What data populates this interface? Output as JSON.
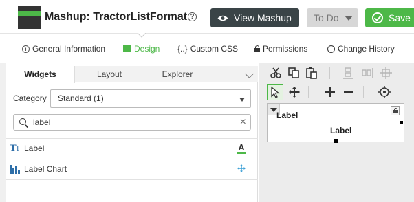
{
  "header": {
    "title": "Mashup: TractorListFormat",
    "help_icon": "?",
    "view_button": "View Mashup",
    "todo_button": "To Do",
    "save_button": "Save"
  },
  "nav": {
    "items": [
      {
        "label": "General Information",
        "icon": "info-circle-icon",
        "active": false
      },
      {
        "label": "Design",
        "icon": "design-icon",
        "active": true
      },
      {
        "label": "Custom CSS",
        "icon": "css-braces-icon",
        "prefix": "{..}",
        "active": false
      },
      {
        "label": "Permissions",
        "icon": "lock-icon",
        "active": false
      },
      {
        "label": "Change History",
        "icon": "clock-icon",
        "active": false
      }
    ],
    "accent_color": "#4db848"
  },
  "left_panel": {
    "tabs": [
      {
        "label": "Widgets",
        "active": true
      },
      {
        "label": "Layout",
        "active": false
      },
      {
        "label": "Explorer",
        "active": false
      }
    ],
    "category_label": "Category",
    "category_value": "Standard (1)",
    "search_value": "label",
    "search_clear": "×",
    "widgets": [
      {
        "label": "Label",
        "icon": "text-label-icon",
        "action_icon": "font-style-icon"
      },
      {
        "label": "Label Chart",
        "icon": "bar-chart-icon",
        "action_icon": "move-icon"
      }
    ]
  },
  "canvas": {
    "widget_title": "Label",
    "widget_text": "Label"
  },
  "toolbar": {
    "icons": [
      "scissors-icon",
      "copy-icon",
      "paste-icon",
      "align-bottom-icon",
      "align-right-icon",
      "align-center-icon",
      "pointer-icon",
      "move-icon",
      "add-icon",
      "remove-icon",
      "target-icon"
    ]
  }
}
